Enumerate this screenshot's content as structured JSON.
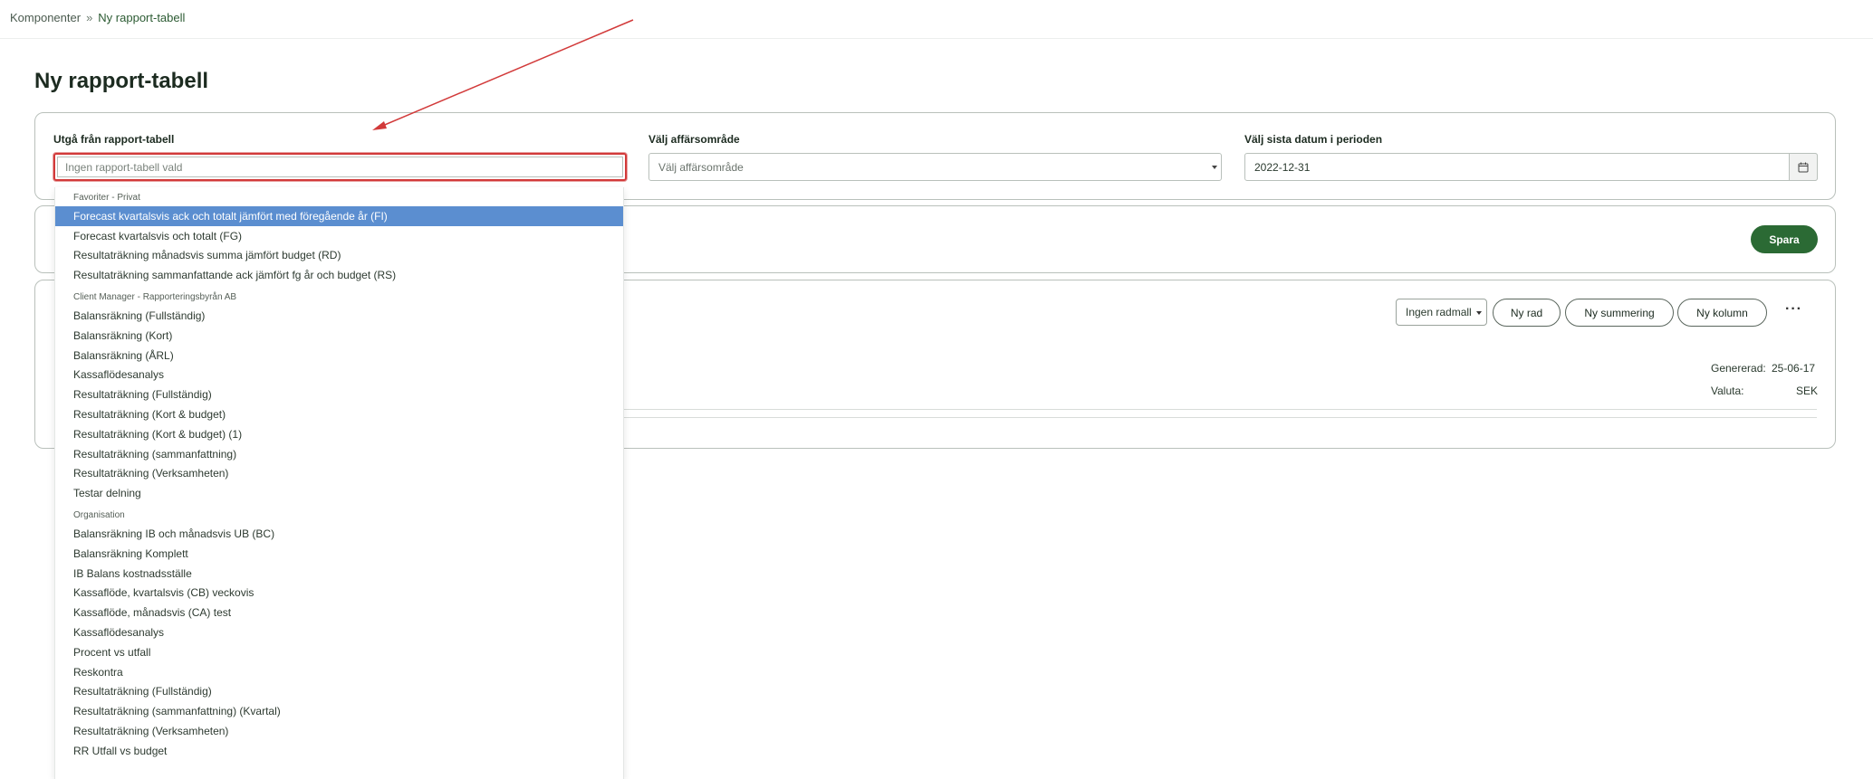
{
  "breadcrumb": {
    "items": [
      "Komponenter",
      "Ny rapport-tabell"
    ]
  },
  "page": {
    "title": "Ny rapport-tabell"
  },
  "filters": {
    "source_label": "Utgå från rapport-tabell",
    "source_placeholder": "Ingen rapport-tabell vald",
    "area_label": "Välj affärsområde",
    "area_value": "Välj affärsområde",
    "date_label": "Välj sista datum i perioden",
    "date_value": "2022-12-31"
  },
  "actions": {
    "save_label": "Spara"
  },
  "table_toolbar": {
    "row_template": "Ingen radmall",
    "new_row": "Ny rad",
    "new_sum": "Ny summering",
    "new_column": "Ny kolumn",
    "more": "···"
  },
  "meta": {
    "generated_label": "Genererad:",
    "generated_value": "25-06-17",
    "currency_label": "Valuta:",
    "currency_value": "SEK"
  },
  "dropdown": {
    "groups": [
      {
        "label": "Favoriter - Privat",
        "items": [
          "Forecast kvartalsvis ack och totalt jämfört med föregående år (FI)",
          "Forecast kvartalsvis och totalt (FG)",
          "Resultaträkning månadsvis summa jämfört budget (RD)",
          "Resultaträkning sammanfattande ack jämfört fg år och budget (RS)"
        ]
      },
      {
        "label": "Client Manager - Rapporteringsbyrån AB",
        "items": [
          "Balansräkning (Fullständig)",
          "Balansräkning (Kort)",
          "Balansräkning (ÅRL)",
          "Kassaflödesanalys",
          "Resultaträkning (Fullständig)",
          "Resultaträkning (Kort & budget)",
          "Resultaträkning (Kort & budget) (1)",
          "Resultaträkning (sammanfattning)",
          "Resultaträkning (Verksamheten)",
          "Testar delning"
        ]
      },
      {
        "label": "Organisation",
        "items": [
          "Balansräkning IB och månadsvis UB (BC)",
          "Balansräkning Komplett",
          "IB Balans kostnadsställe",
          "Kassaflöde, kvartalsvis (CB) veckovis",
          "Kassaflöde, månadsvis (CA) test",
          "Kassaflödesanalys",
          "Procent vs utfall",
          "Reskontra",
          "Resultaträkning (Fullständig)",
          "Resultaträkning (sammanfattning) (Kvartal)",
          "Resultaträkning (Verksamheten)",
          "RR Utfall vs budget"
        ]
      }
    ],
    "highlighted_index": 0,
    "highlight_color": "#5b8ed0"
  },
  "colors": {
    "accent": "#2b6a34",
    "annotation_red": "#d23a3a"
  },
  "icons": {
    "breadcrumb_separator": "»",
    "calendar": "calendar-icon"
  }
}
